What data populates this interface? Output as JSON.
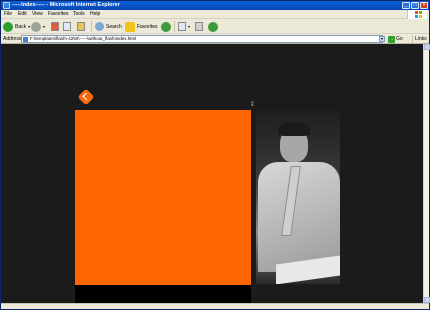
{
  "window": {
    "title": "-----Index----- - Microsoft Internet Explorer",
    "minimize": "_",
    "maximize": "□",
    "close": "×"
  },
  "menu": {
    "items": [
      "File",
      "Edit",
      "View",
      "Favorites",
      "Tools",
      "Help"
    ]
  },
  "toolbar": {
    "back_label": "Back",
    "search_label": "Search",
    "favorites_label": "Favorites"
  },
  "address": {
    "label": "Address",
    "value": "F:\\templates\\flash\\-4250\\-----\\without_flash\\index.html",
    "go_label": "Go",
    "links_label": "Links"
  },
  "colors": {
    "accent": "#ff6601",
    "page_background": "#1b1b1b"
  }
}
